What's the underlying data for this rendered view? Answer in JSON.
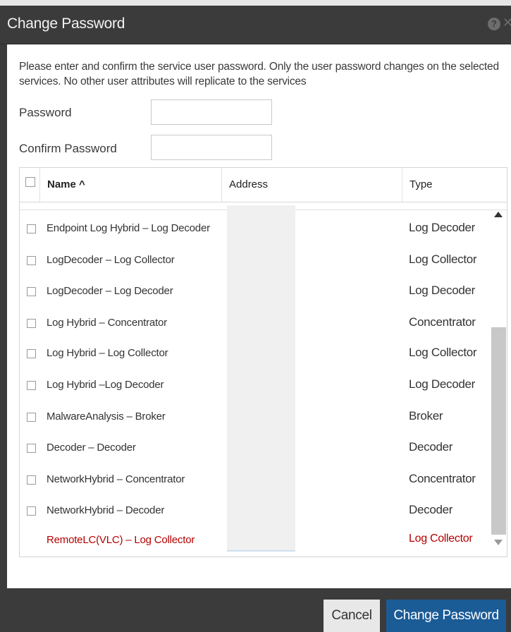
{
  "dialog": {
    "title": "Change Password",
    "help_icon": "question-circle-icon",
    "close_icon": "close-icon"
  },
  "instructions": "Please enter and confirm the service user password. Only the user password changes on the selected services. No other user attributes will replicate to the services",
  "form": {
    "password_label": "Password",
    "password_value": "",
    "confirm_label": "Confirm Password",
    "confirm_value": ""
  },
  "grid": {
    "columns": [
      {
        "label": "Name ^"
      },
      {
        "label": "Address"
      },
      {
        "label": "Type"
      }
    ],
    "rows": [
      {
        "name": "Endpoint Log Hybrid – Log Decoder",
        "address": "",
        "type": "Log Decoder",
        "checked": false,
        "highlight": false
      },
      {
        "name": "LogDecoder – Log Collector",
        "address": "",
        "type": "Log Collector",
        "checked": false,
        "highlight": false
      },
      {
        "name": "LogDecoder – Log Decoder",
        "address": "",
        "type": "Log Decoder",
        "checked": false,
        "highlight": false
      },
      {
        "name": "Log Hybrid – Concentrator",
        "address": "",
        "type": "Concentrator",
        "checked": false,
        "highlight": false
      },
      {
        "name": "Log Hybrid – Log Collector",
        "address": "",
        "type": "Log Collector",
        "checked": false,
        "highlight": false
      },
      {
        "name": "Log Hybrid –Log Decoder",
        "address": "",
        "type": "Log Decoder",
        "checked": false,
        "highlight": false
      },
      {
        "name": "MalwareAnalysis – Broker",
        "address": "",
        "type": "Broker",
        "checked": false,
        "highlight": false
      },
      {
        "name": "Decoder – Decoder",
        "address": "",
        "type": "Decoder",
        "checked": false,
        "highlight": false
      },
      {
        "name": "NetworkHybrid – Concentrator",
        "address": "",
        "type": "Concentrator",
        "checked": false,
        "highlight": false
      },
      {
        "name": "NetworkHybrid – Decoder",
        "address": "",
        "type": "Decoder",
        "checked": false,
        "highlight": false
      },
      {
        "name": "RemoteLC(VLC) – Log Collector",
        "address": "",
        "type": "Log Collector",
        "checked": false,
        "highlight": true
      }
    ]
  },
  "buttons": {
    "cancel": "Cancel",
    "change_password": "Change Password"
  },
  "colors": {
    "title_bar": "#3b3b3b",
    "primary_button": "#1b5b96",
    "highlight_text": "#b40000"
  }
}
